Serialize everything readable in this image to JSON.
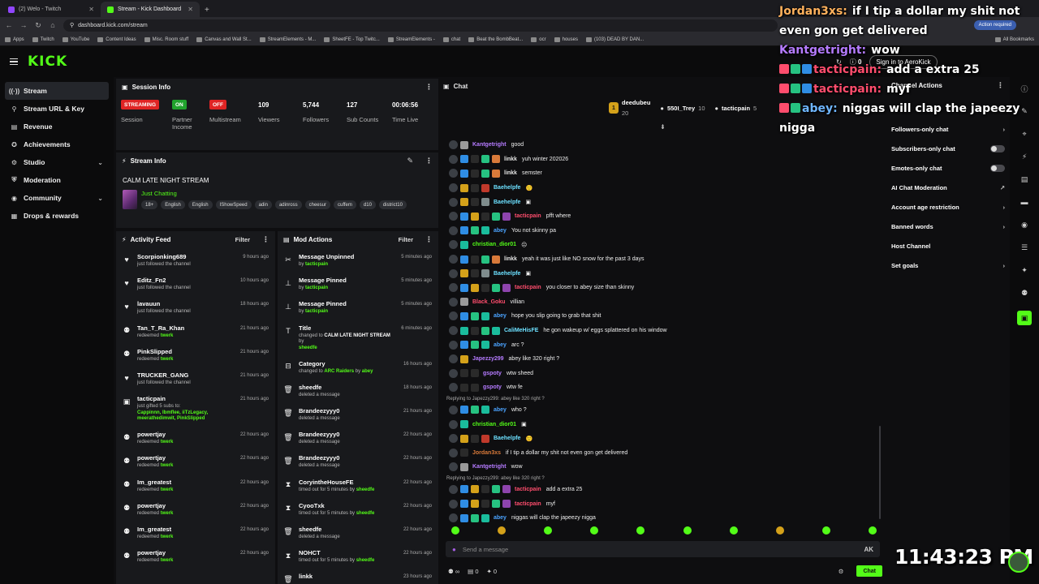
{
  "browser": {
    "tabs": [
      {
        "title": "(2) Welo - Twitch",
        "color": "#9146ff",
        "active": false
      },
      {
        "title": "Stream - Kick Dashboard",
        "color": "#53fc18",
        "active": true
      }
    ],
    "url": "dashboard.kick.com/stream",
    "action_required": "Action required",
    "bookmarks": [
      "Apps",
      "Twitch",
      "YouTube",
      "Content Ideas",
      "Misc. Room stuff",
      "Canvas and Wall St...",
      "StreamElements - M...",
      "SheetFE - Top Twitc...",
      "StreamElements -",
      "chat",
      "Beat the BombBeat...",
      "ocr",
      "houses",
      "(103) DEAD BY DAN..."
    ],
    "all_bookmarks": "All Bookmarks"
  },
  "header": {
    "logo": "KICK",
    "signin": "Sign in to AeroKick",
    "viewer_icon_count": "0"
  },
  "nav": {
    "items": [
      {
        "label": "Stream",
        "icon": "((·))",
        "active": true,
        "chev": ""
      },
      {
        "label": "Stream URL & Key",
        "icon": "⚲",
        "active": false,
        "chev": ""
      },
      {
        "label": "Revenue",
        "icon": "▤",
        "active": false,
        "chev": ""
      },
      {
        "label": "Achievements",
        "icon": "✪",
        "active": false,
        "chev": ""
      },
      {
        "label": "Studio",
        "icon": "⚙",
        "active": false,
        "chev": "⌄"
      },
      {
        "label": "Moderation",
        "icon": "⛨",
        "active": false,
        "chev": ""
      },
      {
        "label": "Community",
        "icon": "◉",
        "active": false,
        "chev": "⌄"
      },
      {
        "label": "Drops & rewards",
        "icon": "▦",
        "active": false,
        "chev": ""
      }
    ]
  },
  "session": {
    "title": "Session Info",
    "status": [
      {
        "badge": "STREAMING",
        "label": "Session",
        "color": "#e02424"
      },
      {
        "badge": "ON",
        "label": "Partner Income",
        "color": "#21a32d"
      },
      {
        "badge": "OFF",
        "label": "Multistream",
        "color": "#e02424"
      }
    ],
    "stats": [
      {
        "num": "109",
        "label": "Viewers"
      },
      {
        "num": "5,744",
        "label": "Followers"
      },
      {
        "num": "127",
        "label": "Sub Counts"
      },
      {
        "num": "00:06:56",
        "label": "Time Live"
      }
    ]
  },
  "stream_info": {
    "title": "Stream Info",
    "stream_title": "CALM LATE NIGHT STREAM",
    "category": "Just Chatting",
    "tags": [
      "18+",
      "English",
      "English",
      "IShowSpeed",
      "adin",
      "adinross",
      "cheesur",
      "cuffem",
      "d10",
      "district10"
    ]
  },
  "activity": {
    "title": "Activity Feed",
    "filter": "Filter",
    "items": [
      {
        "icon": "♥",
        "name": "Scorpionking689",
        "sub": "just followed the channel",
        "hl": "",
        "time": "9 hours ago"
      },
      {
        "icon": "♥",
        "name": "Editz_Fn2",
        "sub": "just followed the channel",
        "hl": "",
        "time": "10 hours ago"
      },
      {
        "icon": "♥",
        "name": "lavauun",
        "sub": "just followed the channel",
        "hl": "",
        "time": "18 hours ago"
      },
      {
        "icon": "⚉",
        "name": "Tan_T_Ra_Khan",
        "sub": "redeemed",
        "hl": "twerk",
        "time": "21 hours ago"
      },
      {
        "icon": "⚉",
        "name": "PinkSlipped",
        "sub": "redeemed",
        "hl": "twerk",
        "time": "21 hours ago"
      },
      {
        "icon": "♥",
        "name": "TRUCKER_GANG",
        "sub": "just followed the channel",
        "hl": "",
        "time": "21 hours ago"
      },
      {
        "icon": "▣",
        "name": "tacticpain",
        "sub": "just gifted 5 subs to:",
        "hl": "Cappinnn, Ibmflee, iiTzLegacy, meerathedimwit, PinkSlipped",
        "time": "21 hours ago",
        "tall": true
      },
      {
        "icon": "⚉",
        "name": "powertjay",
        "sub": "redeemed",
        "hl": "twerk",
        "time": "22 hours ago"
      },
      {
        "icon": "⚉",
        "name": "powertjay",
        "sub": "redeemed",
        "hl": "twerk",
        "time": "22 hours ago"
      },
      {
        "icon": "⚉",
        "name": "Im_greatest",
        "sub": "redeemed",
        "hl": "twerk",
        "time": "22 hours ago"
      },
      {
        "icon": "⚉",
        "name": "powertjay",
        "sub": "redeemed",
        "hl": "twerk",
        "time": "22 hours ago"
      },
      {
        "icon": "⚉",
        "name": "Im_greatest",
        "sub": "redeemed",
        "hl": "twerk",
        "time": "22 hours ago"
      },
      {
        "icon": "⚉",
        "name": "powertjay",
        "sub": "redeemed",
        "hl": "twerk",
        "time": "22 hours ago"
      }
    ]
  },
  "modactions": {
    "title": "Mod Actions",
    "filter": "Filter",
    "items": [
      {
        "icon": "✂",
        "name": "Message Unpinned",
        "pre": "by",
        "hl": "tacticpain",
        "post": "",
        "time": "5 minutes ago"
      },
      {
        "icon": "⊥",
        "name": "Message Pinned",
        "pre": "by",
        "hl": "tacticpain",
        "post": "",
        "time": "5 minutes ago"
      },
      {
        "icon": "⊥",
        "name": "Message Pinned",
        "pre": "by",
        "hl": "tacticpain",
        "post": "",
        "time": "5 minutes ago"
      },
      {
        "icon": "T",
        "name": "Title",
        "pre": "changed to",
        "bold": "CALM LATE NIGHT STREAM",
        "post": "by",
        "hl": "sheedfe",
        "time": "6 minutes ago",
        "tall": true
      },
      {
        "icon": "⊟",
        "name": "Category",
        "pre": "changed to",
        "hl": "ARC Raiders",
        "post": "by",
        "hl2": "abey",
        "time": "16 hours ago"
      },
      {
        "icon": "🗑",
        "name": "sheedfe",
        "pre": "deleted a message",
        "hl": "",
        "post": "",
        "time": "18 hours ago"
      },
      {
        "icon": "🗑",
        "name": "Brandeezyyy0",
        "pre": "deleted a message",
        "hl": "",
        "post": "",
        "time": "21 hours ago"
      },
      {
        "icon": "🗑",
        "name": "Brandeezyyy0",
        "pre": "deleted a message",
        "hl": "",
        "post": "",
        "time": "22 hours ago"
      },
      {
        "icon": "🗑",
        "name": "Brandeezyyy0",
        "pre": "deleted a message",
        "hl": "",
        "post": "",
        "time": "22 hours ago"
      },
      {
        "icon": "⧗",
        "name": "CoryintheHouseFE",
        "pre": "timed out for 5 minutes by",
        "hl": "sheedfe",
        "post": "",
        "time": "22 hours ago"
      },
      {
        "icon": "⧗",
        "name": "CyooTxk",
        "pre": "timed out for 5 minutes by",
        "hl": "sheedfe",
        "post": "",
        "time": "22 hours ago"
      },
      {
        "icon": "🗑",
        "name": "sheedfe",
        "pre": "deleted a message",
        "hl": "",
        "post": "",
        "time": "22 hours ago"
      },
      {
        "icon": "⧗",
        "name": "NOHCT",
        "pre": "timed out for 5 minutes by",
        "hl": "sheedfe",
        "post": "",
        "time": "22 hours ago"
      },
      {
        "icon": "🗑",
        "name": "linkk",
        "pre": "",
        "hl": "",
        "post": "",
        "time": "23 hours ago"
      }
    ]
  },
  "chat": {
    "title": "Chat",
    "podium": [
      {
        "rank": "1",
        "name": "deedubeu",
        "val": "20"
      },
      {
        "rank": "",
        "name": "550I_Trey",
        "val": "10"
      },
      {
        "rank": "",
        "name": "tacticpain",
        "val": "5"
      }
    ],
    "lines": [
      {
        "user": "Kantgetright",
        "color": "#b57bff",
        "badges": [
          "#9a9a9a"
        ],
        "msg": "good"
      },
      {
        "user": "linkk",
        "color": "#e6e6e6",
        "badges": [
          "#2f8de4",
          "#2a2a2a",
          "#26c281",
          "#d97a3a"
        ],
        "msg": "yuh winter 202026"
      },
      {
        "user": "linkk",
        "color": "#e6e6e6",
        "badges": [
          "#2f8de4",
          "#2a2a2a",
          "#26c281",
          "#d97a3a"
        ],
        "msg": "semster"
      },
      {
        "user": "Baehelpfe",
        "color": "#6ce0ff",
        "badges": [
          "#d4a11a",
          "#2a2a2a",
          "#c0392b"
        ],
        "msg": "🙂"
      },
      {
        "user": "Baehelpfe",
        "color": "#6ce0ff",
        "badges": [
          "#d4a11a",
          "#2a2a2a",
          "#7f8c8d"
        ],
        "msg": "▣"
      },
      {
        "user": "tacticpain",
        "color": "#ff4d6d",
        "badges": [
          "#2f8de4",
          "#d4a11a",
          "#2a2a2a",
          "#26c281",
          "#8e44ad"
        ],
        "msg": "pfft where"
      },
      {
        "user": "abey",
        "color": "#4ba3ff",
        "badges": [
          "#2f8de4",
          "#26c281",
          "#1abc9c"
        ],
        "msg": "You not skinny pa"
      },
      {
        "user": "christian_dior01",
        "color": "#53fc18",
        "badges": [
          "#1abc9c"
        ],
        "msg": "☹"
      },
      {
        "user": "linkk",
        "color": "#e6e6e6",
        "badges": [
          "#2f8de4",
          "#2a2a2a",
          "#26c281",
          "#d97a3a"
        ],
        "msg": "yeah it was just like NO snow for the past 3 days"
      },
      {
        "user": "Baehelpfe",
        "color": "#6ce0ff",
        "badges": [
          "#d4a11a",
          "#2a2a2a",
          "#7f8c8d"
        ],
        "msg": "▣"
      },
      {
        "user": "tacticpain",
        "color": "#ff4d6d",
        "badges": [
          "#2f8de4",
          "#d4a11a",
          "#2a2a2a",
          "#26c281",
          "#8e44ad"
        ],
        "msg": "you closer to abey size than skinny"
      },
      {
        "user": "Black_Goku",
        "color": "#ff4d6d",
        "badges": [
          "#9a9a9a"
        ],
        "msg": "villian"
      },
      {
        "user": "abey",
        "color": "#4ba3ff",
        "badges": [
          "#2f8de4",
          "#26c281",
          "#1abc9c"
        ],
        "msg": "hope you slip going to grab that shit"
      },
      {
        "user": "CaliMeHisFE",
        "color": "#6ce0ff",
        "badges": [
          "#1abc9c",
          "#2a2a2a",
          "#26c281",
          "#1abc9c"
        ],
        "msg": "he gon wakeup w/ eggs splattered on his window"
      },
      {
        "user": "abey",
        "color": "#4ba3ff",
        "badges": [
          "#2f8de4",
          "#26c281",
          "#1abc9c"
        ],
        "msg": "arc ?"
      },
      {
        "user": "Japezzy299",
        "color": "#b57bff",
        "badges": [
          "#d4a11a"
        ],
        "msg": "abey like 320 right ?"
      },
      {
        "user": "gspoty",
        "color": "#b57bff",
        "badges": [
          "#2a2a2a",
          "#2a2a2a"
        ],
        "msg": "wtw sheed"
      },
      {
        "user": "gspoty",
        "color": "#b57bff",
        "badges": [
          "#2a2a2a",
          "#2a2a2a"
        ],
        "msg": "wtw fe",
        "reply_after": "Replying to Japezzy299: abey like 320 right ?"
      },
      {
        "user": "abey",
        "color": "#4ba3ff",
        "badges": [
          "#2f8de4",
          "#26c281",
          "#1abc9c"
        ],
        "msg": "who ?"
      },
      {
        "user": "christian_dior01",
        "color": "#53fc18",
        "badges": [
          "#1abc9c"
        ],
        "msg": "▣"
      },
      {
        "user": "Baehelpfe",
        "color": "#6ce0ff",
        "badges": [
          "#d4a11a",
          "#2a2a2a",
          "#c0392b"
        ],
        "msg": "🙂"
      },
      {
        "user": "Jordan3xs",
        "color": "#d97a3a",
        "badges": [
          "#2a2a2a"
        ],
        "msg": "if I tip a dollar my shit not even gon get delivered"
      },
      {
        "user": "Kantgetright",
        "color": "#b57bff",
        "badges": [
          "#9a9a9a"
        ],
        "msg": "wow",
        "reply_after": "Replying to Japezzy299: abey like 320 right ?"
      },
      {
        "user": "tacticpain",
        "color": "#ff4d6d",
        "badges": [
          "#2f8de4",
          "#d4a11a",
          "#2a2a2a",
          "#26c281",
          "#8e44ad"
        ],
        "msg": "add a extra 25"
      },
      {
        "user": "tacticpain",
        "color": "#ff4d6d",
        "badges": [
          "#2f8de4",
          "#d4a11a",
          "#2a2a2a",
          "#26c281",
          "#8e44ad"
        ],
        "msg": "myf"
      },
      {
        "user": "abey",
        "color": "#4ba3ff",
        "badges": [
          "#2f8de4",
          "#26c281",
          "#1abc9c"
        ],
        "msg": "niggas will clap the japeezy nigga"
      }
    ],
    "input_placeholder": "Send a message",
    "points": "∞",
    "counter_a": "0",
    "counter_b": "0",
    "send": "Chat"
  },
  "channel_actions": {
    "title": "Channel Actions",
    "items": [
      {
        "label": "Followers-only chat",
        "type": "chev"
      },
      {
        "label": "Subscribers-only chat",
        "type": "toggle"
      },
      {
        "label": "Emotes-only chat",
        "type": "toggle"
      },
      {
        "label": "AI Chat Moderation",
        "type": "ext"
      },
      {
        "label": "Account age restriction",
        "type": "chev"
      },
      {
        "label": "Banned words",
        "type": "chev"
      },
      {
        "label": "Host Channel",
        "type": "none"
      },
      {
        "label": "Set goals",
        "type": "chev"
      }
    ]
  },
  "overlay": {
    "lines": [
      {
        "name": "Jordan3xs:",
        "color": "#ffb15c",
        "text": "if I tip a dollar my shit not even gon get delivered"
      },
      {
        "name": "Kantgetright:",
        "color": "#b57bff",
        "text": "wow"
      },
      {
        "name": "tacticpain:",
        "color": "#ff4d6d",
        "text": "add a extra 25"
      },
      {
        "name": "tacticpain:",
        "color": "#ff4d6d",
        "text": "myf"
      },
      {
        "name": "abey:",
        "color": "#6fb6ff",
        "text": "niggas will clap the japeezy nigga"
      }
    ],
    "clock": "11:43:23 PM"
  }
}
